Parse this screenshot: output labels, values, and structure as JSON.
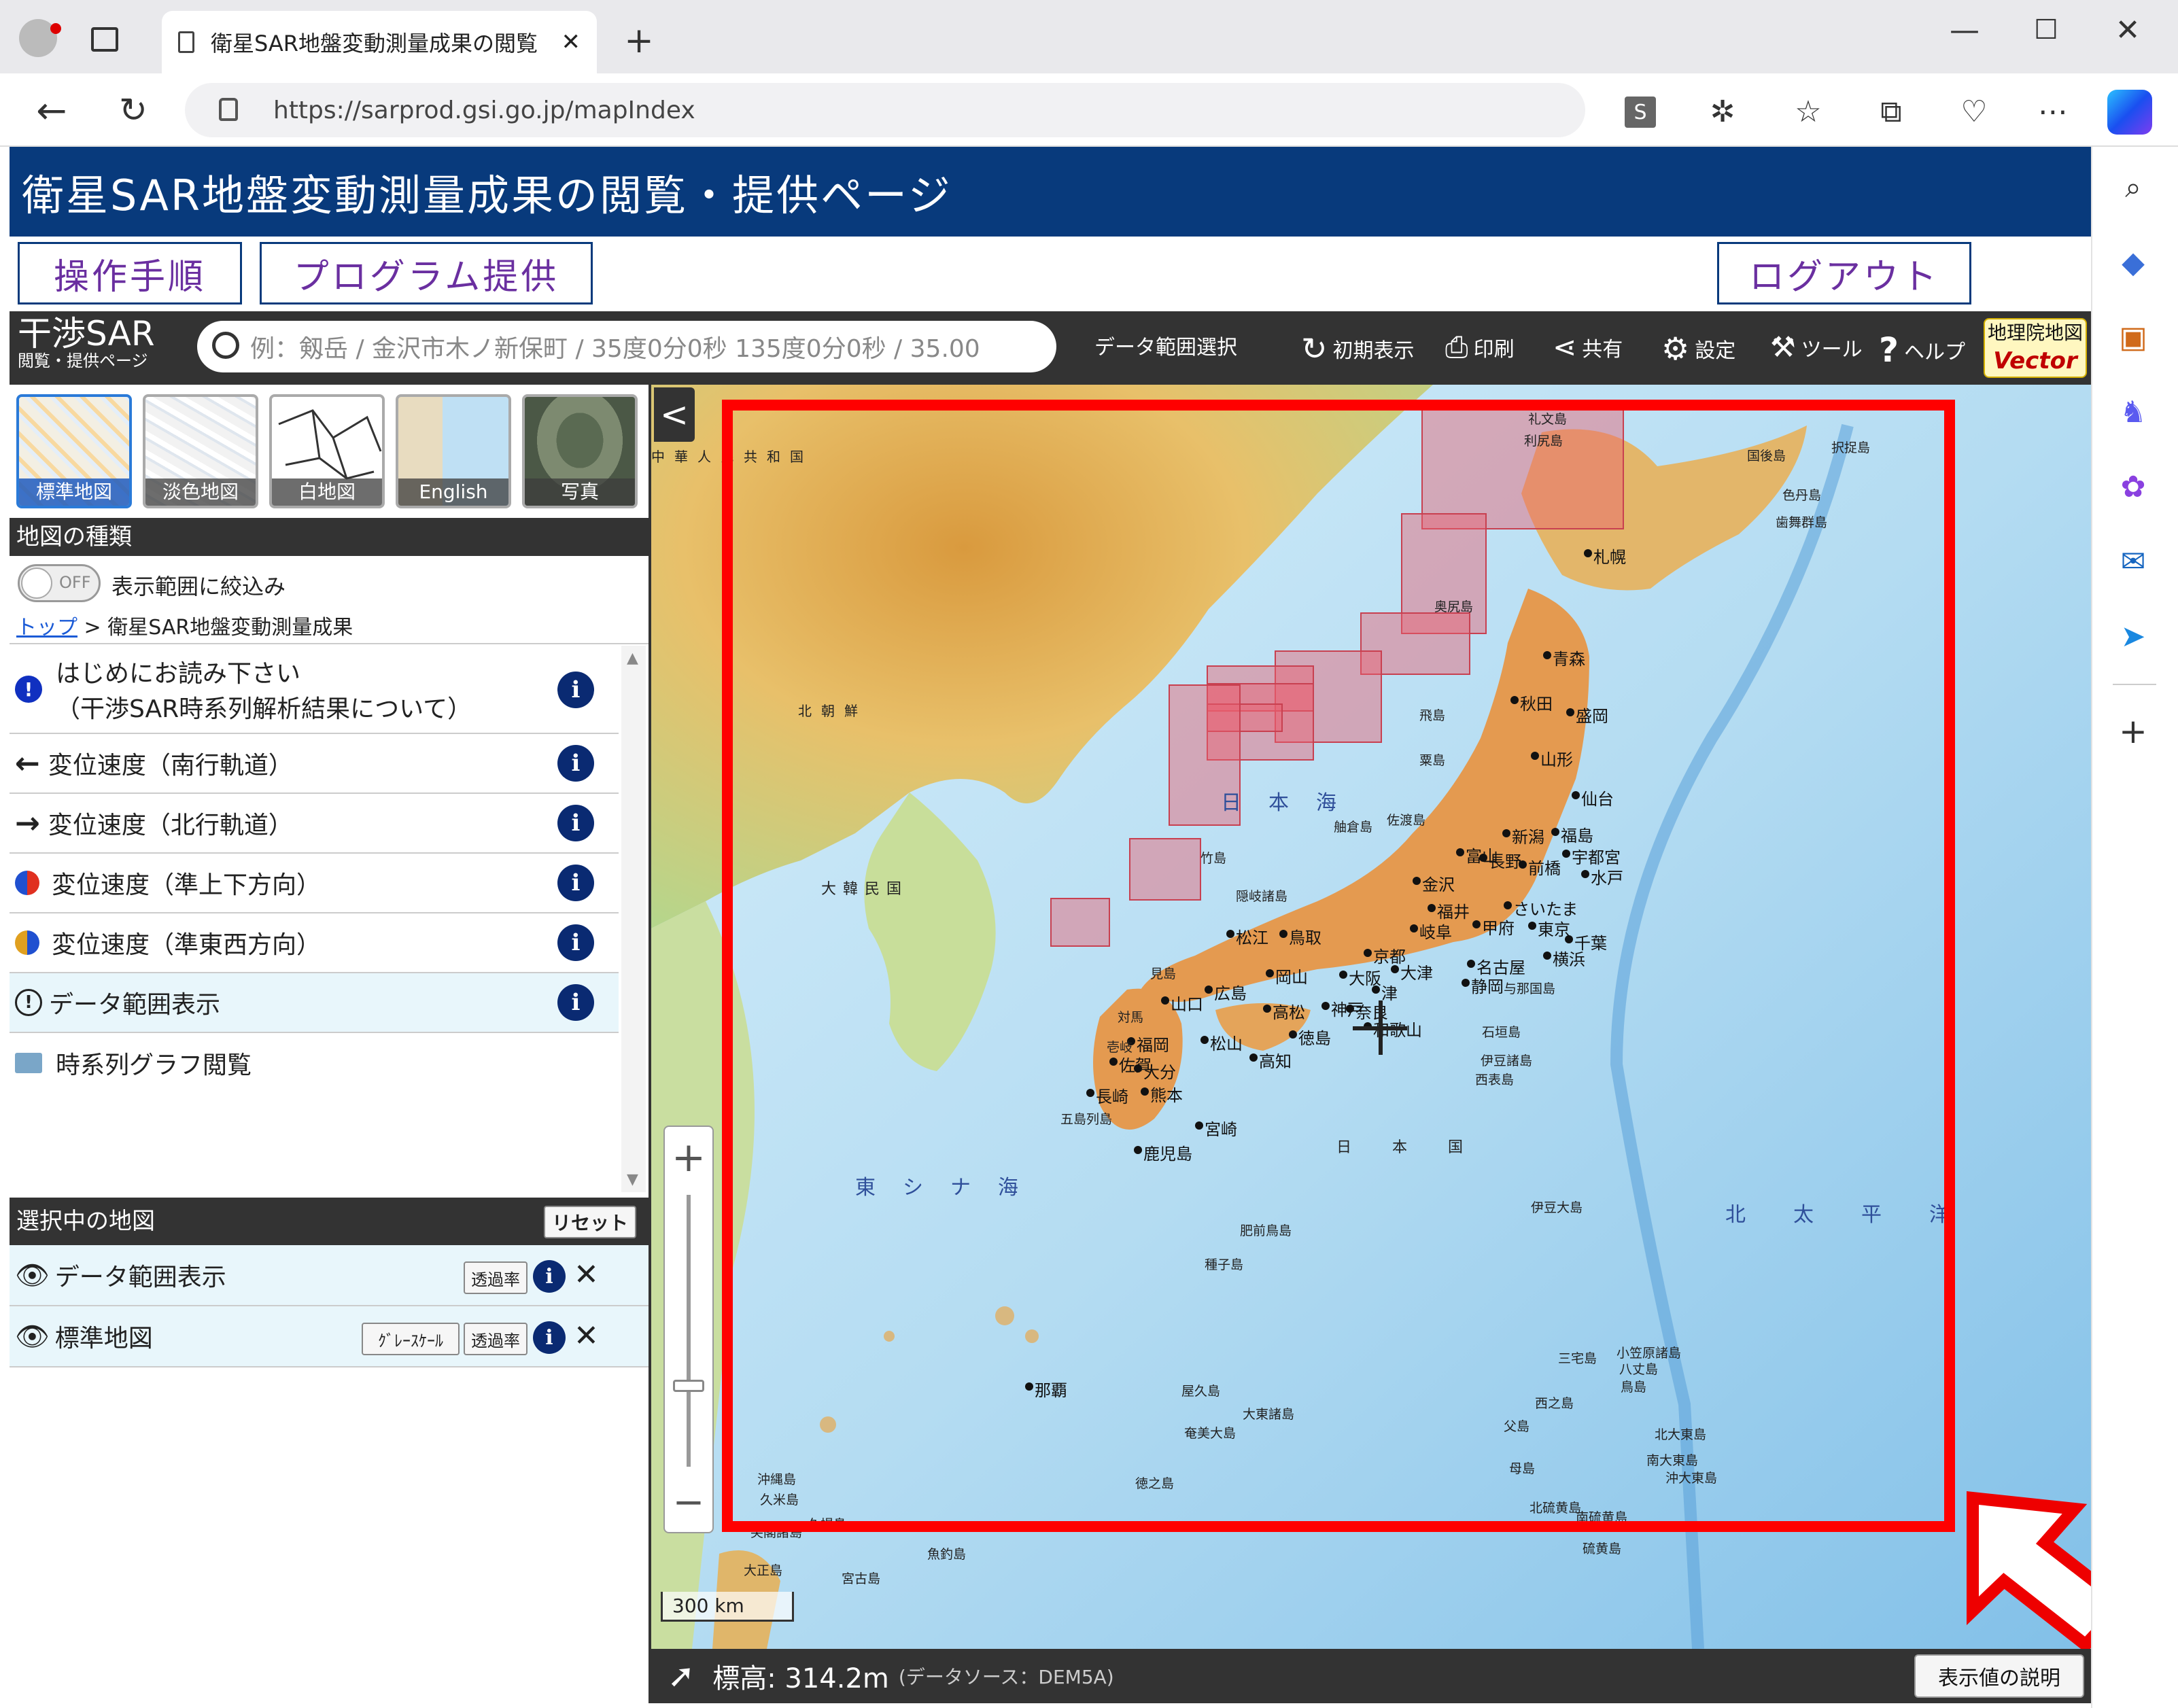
{
  "browser": {
    "tab_title": "衛星SAR地盤変動測量成果の閲覧",
    "url": "https://sarprod.gsi.go.jp/mapIndex"
  },
  "page": {
    "banner_title": "衛星SAR地盤変動測量成果の閲覧・提供ページ",
    "nav": {
      "procedure": "操作手順",
      "program": "プログラム提供",
      "logout": "ログアウト"
    }
  },
  "mapbar": {
    "logo_main": "干渉SAR",
    "logo_sub": "閲覧・提供ページ",
    "search_placeholder": "例：剱岳 / 金沢市木ノ新保町 / 35度0分0秒 135度0分0秒 / 35.00",
    "data_range_select": "データ範囲選択",
    "initial_view": "初期表示",
    "print": "印刷",
    "share": "共有",
    "settings": "設定",
    "tools": "ツール",
    "help": "ヘルプ",
    "gsi_logo_top": "地理院地図",
    "gsi_logo_bottom": "Vector"
  },
  "basemaps": [
    {
      "label": "標準地図"
    },
    {
      "label": "淡色地図"
    },
    {
      "label": "白地図"
    },
    {
      "label": "English"
    },
    {
      "label": "写真"
    }
  ],
  "panel": {
    "map_type_header": "地図の種類",
    "toggle_state": "OFF",
    "toggle_label": "表示範囲に絞込み",
    "breadcrumb_top": "トップ",
    "breadcrumb_sep": ">",
    "breadcrumb_current": "衛星SAR地盤変動測量成果",
    "layers": [
      {
        "line1": "はじめにお読み下さい",
        "line2": "（干渉SAR時系列解析結果について）"
      },
      {
        "line1": "変位速度（南行軌道）"
      },
      {
        "line1": "変位速度（北行軌道）"
      },
      {
        "line1": "変位速度（準上下方向）"
      },
      {
        "line1": "変位速度（準東西方向）"
      },
      {
        "line1": "データ範囲表示"
      },
      {
        "line1": "時系列グラフ閲覧"
      }
    ],
    "selected_header": "選択中の地図",
    "reset": "リセット",
    "selected": [
      {
        "name": "データ範囲表示",
        "opacity": "透過率"
      },
      {
        "name": "標準地図",
        "grayscale": "ｸﾞﾚｰｽｹｰﾙ",
        "opacity": "透過率"
      }
    ]
  },
  "map": {
    "seas": {
      "japan_sea": "日本海",
      "east_china_sea": "東シナ海",
      "pacific": "北太平洋",
      "china": "中華人民共和国",
      "north_korea": "北朝鮮",
      "south_korea": "大韓民国",
      "japan": "日本国"
    },
    "cities": [
      "札幌",
      "青森",
      "秋田",
      "盛岡",
      "山形",
      "仙台",
      "新潟",
      "福島",
      "富山",
      "長野",
      "前橋",
      "宇都宮",
      "水戸",
      "金沢",
      "福井",
      "甲府",
      "さいたま",
      "東京",
      "千葉",
      "横浜",
      "岐阜",
      "名古屋",
      "静岡",
      "京都",
      "大阪",
      "大津",
      "津",
      "神戸",
      "和歌山",
      "奈良",
      "鳥取",
      "松江",
      "岡山",
      "広島",
      "山口",
      "高松",
      "徳島",
      "松山",
      "高知",
      "福岡",
      "佐賀",
      "長崎",
      "熊本",
      "大分",
      "宮崎",
      "鹿児島",
      "那覇"
    ],
    "islands": [
      "礼文島",
      "利尻島",
      "国後島",
      "択捉島",
      "色丹島",
      "歯舞群島",
      "奥尻島",
      "飛島",
      "粟島",
      "佐渡島",
      "舳倉島",
      "竹島",
      "隠岐諸島",
      "見島",
      "対馬",
      "壱岐",
      "五島列島",
      "肥前鳥島",
      "種子島",
      "屋久島",
      "奄美大島",
      "徳之島",
      "沖縄島",
      "久米島",
      "尖閣諸島",
      "久場島",
      "魚釣島",
      "大正島",
      "宮古島",
      "与那国島",
      "石垣島",
      "西表島",
      "伊豆大島",
      "三宅島",
      "八丈島",
      "鳥島",
      "西之島",
      "父島",
      "母島",
      "北大東島",
      "南大東島",
      "沖大東島",
      "北硫黄島",
      "硫黄島",
      "南硫黄島",
      "大東諸島",
      "小笠原諸島",
      "伊豆諸島"
    ],
    "scale": "300 km",
    "zoom_in": "+",
    "zoom_out": "−",
    "collapse": "<"
  },
  "status": {
    "elevation": "標高: 314.2m",
    "source": "(データソース：DEM5A)",
    "explain_button": "表示値の説明"
  },
  "colors": {
    "banner": "#083a7c",
    "highlight": "#ff0000",
    "coverage": "#e8606e"
  }
}
